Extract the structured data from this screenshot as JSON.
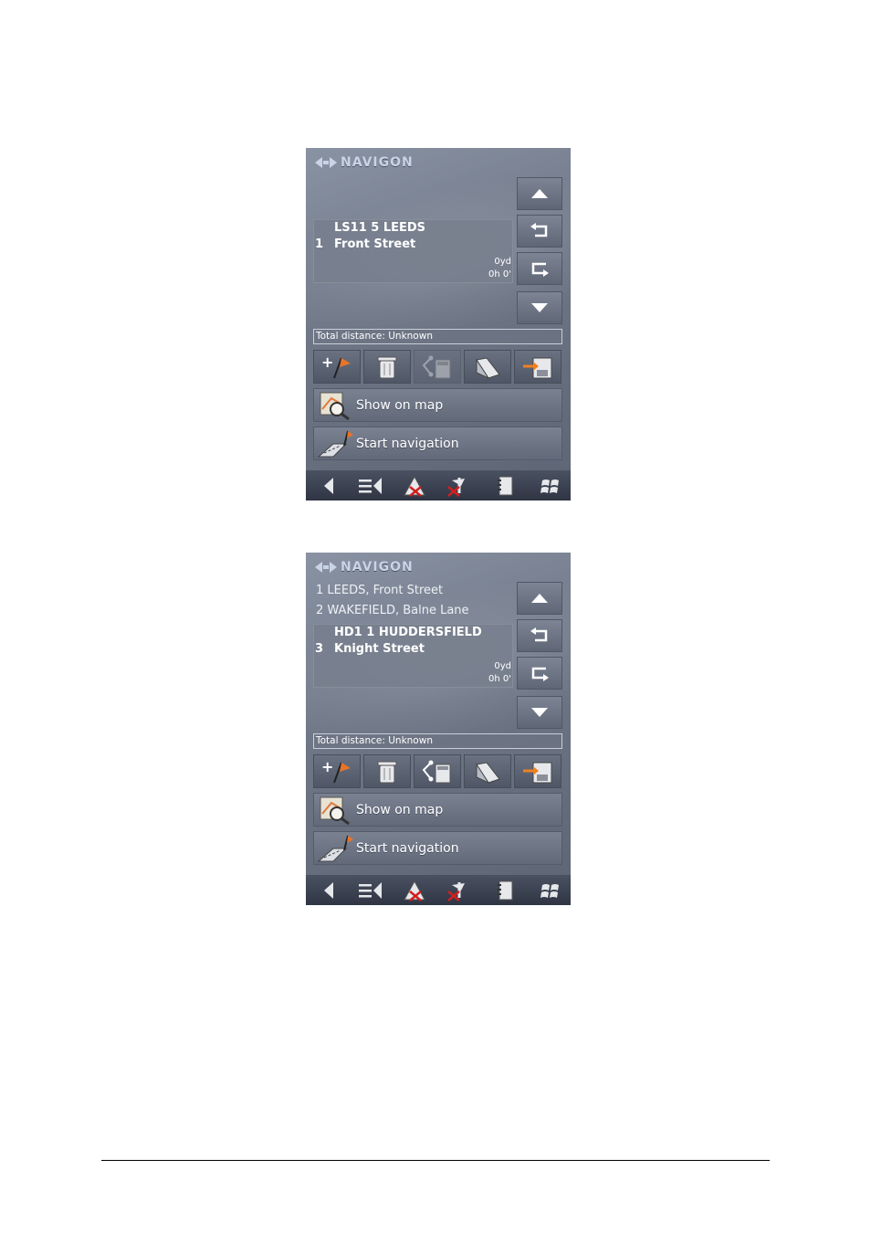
{
  "screens": [
    {
      "brand": "NAVIGON",
      "previous_items": [],
      "current": {
        "zip_city": "LS11 5 LEEDS",
        "index": "1",
        "street": "Front Street",
        "distance": "0yd",
        "time": "0h 0'"
      },
      "total_distance": "Total distance: Unknown",
      "tool_state": {
        "calculate_enabled": false
      },
      "show_on_map": "Show on map",
      "start_navigation": "Start navigation"
    },
    {
      "brand": "NAVIGON",
      "previous_items": [
        "1 LEEDS, Front Street",
        "2 WAKEFIELD, Balne Lane"
      ],
      "current": {
        "zip_city": "HD1 1 HUDDERSFIELD",
        "index": "3",
        "street": "Knight Street",
        "distance": "0yd",
        "time": "0h 0'"
      },
      "total_distance": "Total distance: Unknown",
      "tool_state": {
        "calculate_enabled": true
      },
      "show_on_map": "Show on map",
      "start_navigation": "Start navigation"
    }
  ],
  "icons": {
    "up": "triangle-up-icon",
    "back_arrow": "return-left-icon",
    "forward_arrow": "return-right-icon",
    "down": "triangle-down-icon",
    "add": "add-destination-flag-icon",
    "delete": "trash-icon",
    "calculate": "route-calculator-icon",
    "load": "folder-open-icon",
    "save": "save-route-icon",
    "map": "map-magnifier-icon",
    "nav": "start-navigation-flag-icon",
    "bb_back": "back-arrow-icon",
    "bb_menu": "menu-list-icon",
    "bb_traffic": "traffic-warning-icon",
    "bb_gps": "gps-satellite-icon",
    "bb_notes": "notebook-icon",
    "bb_windows": "windows-start-icon"
  }
}
